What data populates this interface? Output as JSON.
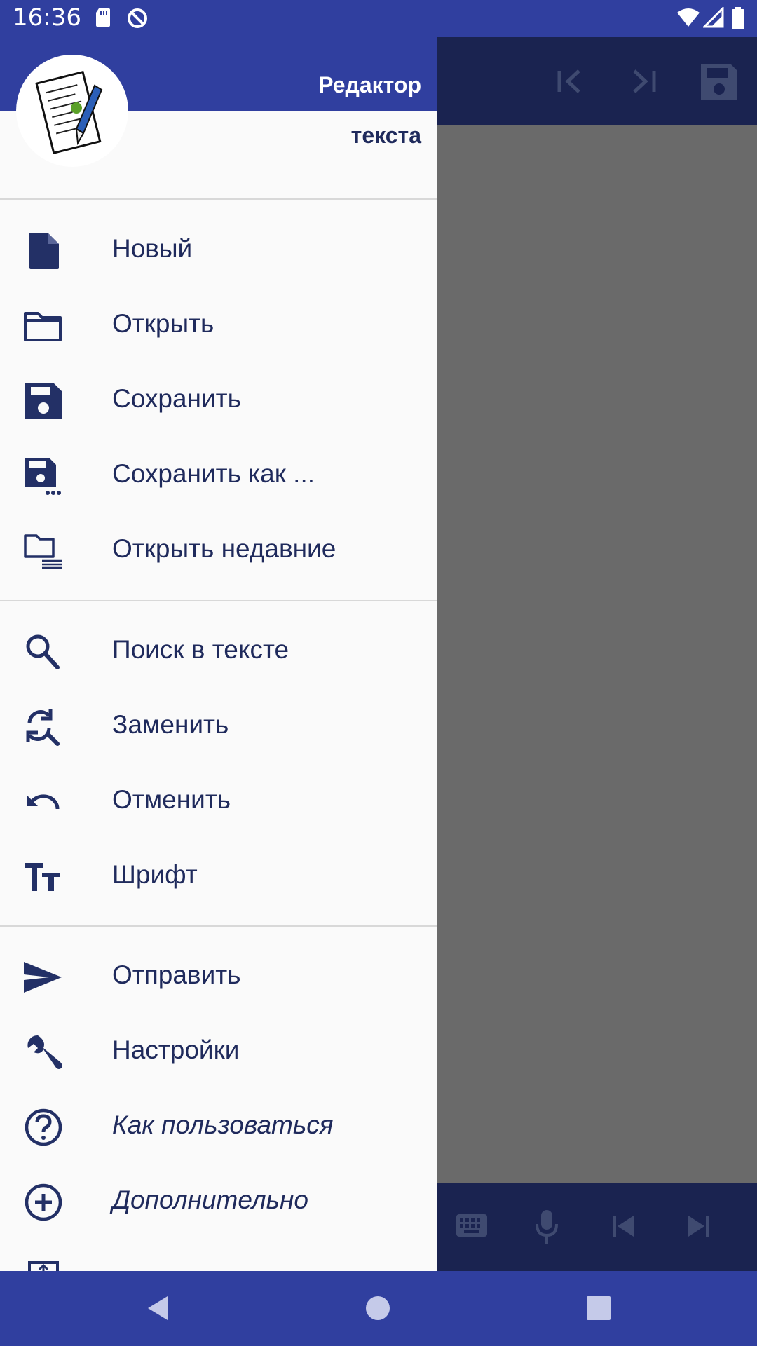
{
  "status": {
    "time": "16:36"
  },
  "drawer": {
    "title_line1": "Редактор",
    "title_line2": "текста",
    "groups": [
      [
        {
          "label": "Новый",
          "icon": "new-file-icon"
        },
        {
          "label": "Открыть",
          "icon": "folder-icon"
        },
        {
          "label": "Сохранить",
          "icon": "save-icon"
        },
        {
          "label": "Сохранить как ...",
          "icon": "save-as-icon"
        },
        {
          "label": "Открыть недавние",
          "icon": "recent-files-icon"
        }
      ],
      [
        {
          "label": "Поиск в тексте",
          "icon": "search-icon"
        },
        {
          "label": "Заменить",
          "icon": "find-replace-icon"
        },
        {
          "label": "Отменить",
          "icon": "undo-icon"
        },
        {
          "label": "Шрифт",
          "icon": "font-icon"
        }
      ],
      [
        {
          "label": "Отправить",
          "icon": "send-icon"
        },
        {
          "label": "Настройки",
          "icon": "wrench-icon"
        },
        {
          "label": "Как пользоваться",
          "icon": "help-icon"
        },
        {
          "label": "Дополнительно",
          "icon": "add-circle-icon"
        }
      ]
    ]
  },
  "colors": {
    "primary": "#303f9f",
    "dark": "#1a2350",
    "text": "#1f2a5c",
    "scrim": "#6a6a6a"
  }
}
